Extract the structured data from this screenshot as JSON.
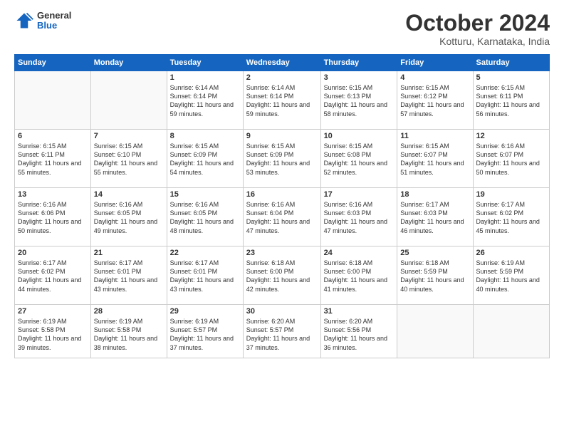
{
  "header": {
    "logo_general": "General",
    "logo_blue": "Blue",
    "month_title": "October 2024",
    "location": "Kotturu, Karnataka, India"
  },
  "weekdays": [
    "Sunday",
    "Monday",
    "Tuesday",
    "Wednesday",
    "Thursday",
    "Friday",
    "Saturday"
  ],
  "weeks": [
    [
      {
        "day": "",
        "info": ""
      },
      {
        "day": "",
        "info": ""
      },
      {
        "day": "1",
        "info": "Sunrise: 6:14 AM\nSunset: 6:14 PM\nDaylight: 11 hours and 59 minutes."
      },
      {
        "day": "2",
        "info": "Sunrise: 6:14 AM\nSunset: 6:14 PM\nDaylight: 11 hours and 59 minutes."
      },
      {
        "day": "3",
        "info": "Sunrise: 6:15 AM\nSunset: 6:13 PM\nDaylight: 11 hours and 58 minutes."
      },
      {
        "day": "4",
        "info": "Sunrise: 6:15 AM\nSunset: 6:12 PM\nDaylight: 11 hours and 57 minutes."
      },
      {
        "day": "5",
        "info": "Sunrise: 6:15 AM\nSunset: 6:11 PM\nDaylight: 11 hours and 56 minutes."
      }
    ],
    [
      {
        "day": "6",
        "info": "Sunrise: 6:15 AM\nSunset: 6:11 PM\nDaylight: 11 hours and 55 minutes."
      },
      {
        "day": "7",
        "info": "Sunrise: 6:15 AM\nSunset: 6:10 PM\nDaylight: 11 hours and 55 minutes."
      },
      {
        "day": "8",
        "info": "Sunrise: 6:15 AM\nSunset: 6:09 PM\nDaylight: 11 hours and 54 minutes."
      },
      {
        "day": "9",
        "info": "Sunrise: 6:15 AM\nSunset: 6:09 PM\nDaylight: 11 hours and 53 minutes."
      },
      {
        "day": "10",
        "info": "Sunrise: 6:15 AM\nSunset: 6:08 PM\nDaylight: 11 hours and 52 minutes."
      },
      {
        "day": "11",
        "info": "Sunrise: 6:15 AM\nSunset: 6:07 PM\nDaylight: 11 hours and 51 minutes."
      },
      {
        "day": "12",
        "info": "Sunrise: 6:16 AM\nSunset: 6:07 PM\nDaylight: 11 hours and 50 minutes."
      }
    ],
    [
      {
        "day": "13",
        "info": "Sunrise: 6:16 AM\nSunset: 6:06 PM\nDaylight: 11 hours and 50 minutes."
      },
      {
        "day": "14",
        "info": "Sunrise: 6:16 AM\nSunset: 6:05 PM\nDaylight: 11 hours and 49 minutes."
      },
      {
        "day": "15",
        "info": "Sunrise: 6:16 AM\nSunset: 6:05 PM\nDaylight: 11 hours and 48 minutes."
      },
      {
        "day": "16",
        "info": "Sunrise: 6:16 AM\nSunset: 6:04 PM\nDaylight: 11 hours and 47 minutes."
      },
      {
        "day": "17",
        "info": "Sunrise: 6:16 AM\nSunset: 6:03 PM\nDaylight: 11 hours and 47 minutes."
      },
      {
        "day": "18",
        "info": "Sunrise: 6:17 AM\nSunset: 6:03 PM\nDaylight: 11 hours and 46 minutes."
      },
      {
        "day": "19",
        "info": "Sunrise: 6:17 AM\nSunset: 6:02 PM\nDaylight: 11 hours and 45 minutes."
      }
    ],
    [
      {
        "day": "20",
        "info": "Sunrise: 6:17 AM\nSunset: 6:02 PM\nDaylight: 11 hours and 44 minutes."
      },
      {
        "day": "21",
        "info": "Sunrise: 6:17 AM\nSunset: 6:01 PM\nDaylight: 11 hours and 43 minutes."
      },
      {
        "day": "22",
        "info": "Sunrise: 6:17 AM\nSunset: 6:01 PM\nDaylight: 11 hours and 43 minutes."
      },
      {
        "day": "23",
        "info": "Sunrise: 6:18 AM\nSunset: 6:00 PM\nDaylight: 11 hours and 42 minutes."
      },
      {
        "day": "24",
        "info": "Sunrise: 6:18 AM\nSunset: 6:00 PM\nDaylight: 11 hours and 41 minutes."
      },
      {
        "day": "25",
        "info": "Sunrise: 6:18 AM\nSunset: 5:59 PM\nDaylight: 11 hours and 40 minutes."
      },
      {
        "day": "26",
        "info": "Sunrise: 6:19 AM\nSunset: 5:59 PM\nDaylight: 11 hours and 40 minutes."
      }
    ],
    [
      {
        "day": "27",
        "info": "Sunrise: 6:19 AM\nSunset: 5:58 PM\nDaylight: 11 hours and 39 minutes."
      },
      {
        "day": "28",
        "info": "Sunrise: 6:19 AM\nSunset: 5:58 PM\nDaylight: 11 hours and 38 minutes."
      },
      {
        "day": "29",
        "info": "Sunrise: 6:19 AM\nSunset: 5:57 PM\nDaylight: 11 hours and 37 minutes."
      },
      {
        "day": "30",
        "info": "Sunrise: 6:20 AM\nSunset: 5:57 PM\nDaylight: 11 hours and 37 minutes."
      },
      {
        "day": "31",
        "info": "Sunrise: 6:20 AM\nSunset: 5:56 PM\nDaylight: 11 hours and 36 minutes."
      },
      {
        "day": "",
        "info": ""
      },
      {
        "day": "",
        "info": ""
      }
    ]
  ]
}
